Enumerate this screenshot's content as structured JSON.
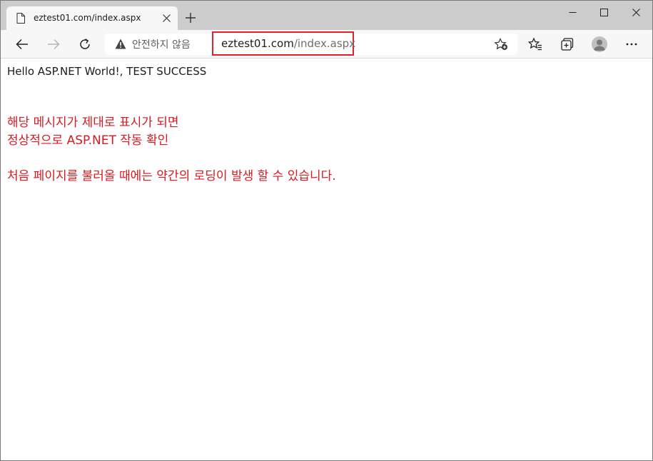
{
  "tab": {
    "title": "eztest01.com/index.aspx"
  },
  "address_bar": {
    "security_label": "안전하지 않음",
    "url_host": "eztest01.com",
    "url_path": "/index.aspx"
  },
  "page": {
    "hello": "Hello ASP.NET World!, TEST SUCCESS",
    "red_lines": [
      "해당 메시지가 제대로 표시가 되면",
      "정상적으로 ASP.NET 작동 확인",
      "처음 페이지를 불러올 때에는 약간의 로딩이 발생 할 수 있습니다."
    ]
  },
  "icons": {
    "tab_favicon": "page-icon",
    "tab_close": "close-icon",
    "new_tab": "plus-icon",
    "minimize": "minimize-icon",
    "maximize": "maximize-icon",
    "close": "close-icon",
    "back": "arrow-left-icon",
    "forward": "arrow-right-icon",
    "refresh": "refresh-icon",
    "warning": "warning-icon",
    "add_favorite": "star-plus-icon",
    "favorites": "favorites-icon",
    "collections": "collections-icon",
    "profile": "profile-icon",
    "menu": "ellipsis-icon"
  },
  "colors": {
    "highlight_border": "#d9252b",
    "message_red": "#d71920",
    "titlebar": "#cccccc",
    "toolbar": "#f7f7f7"
  }
}
